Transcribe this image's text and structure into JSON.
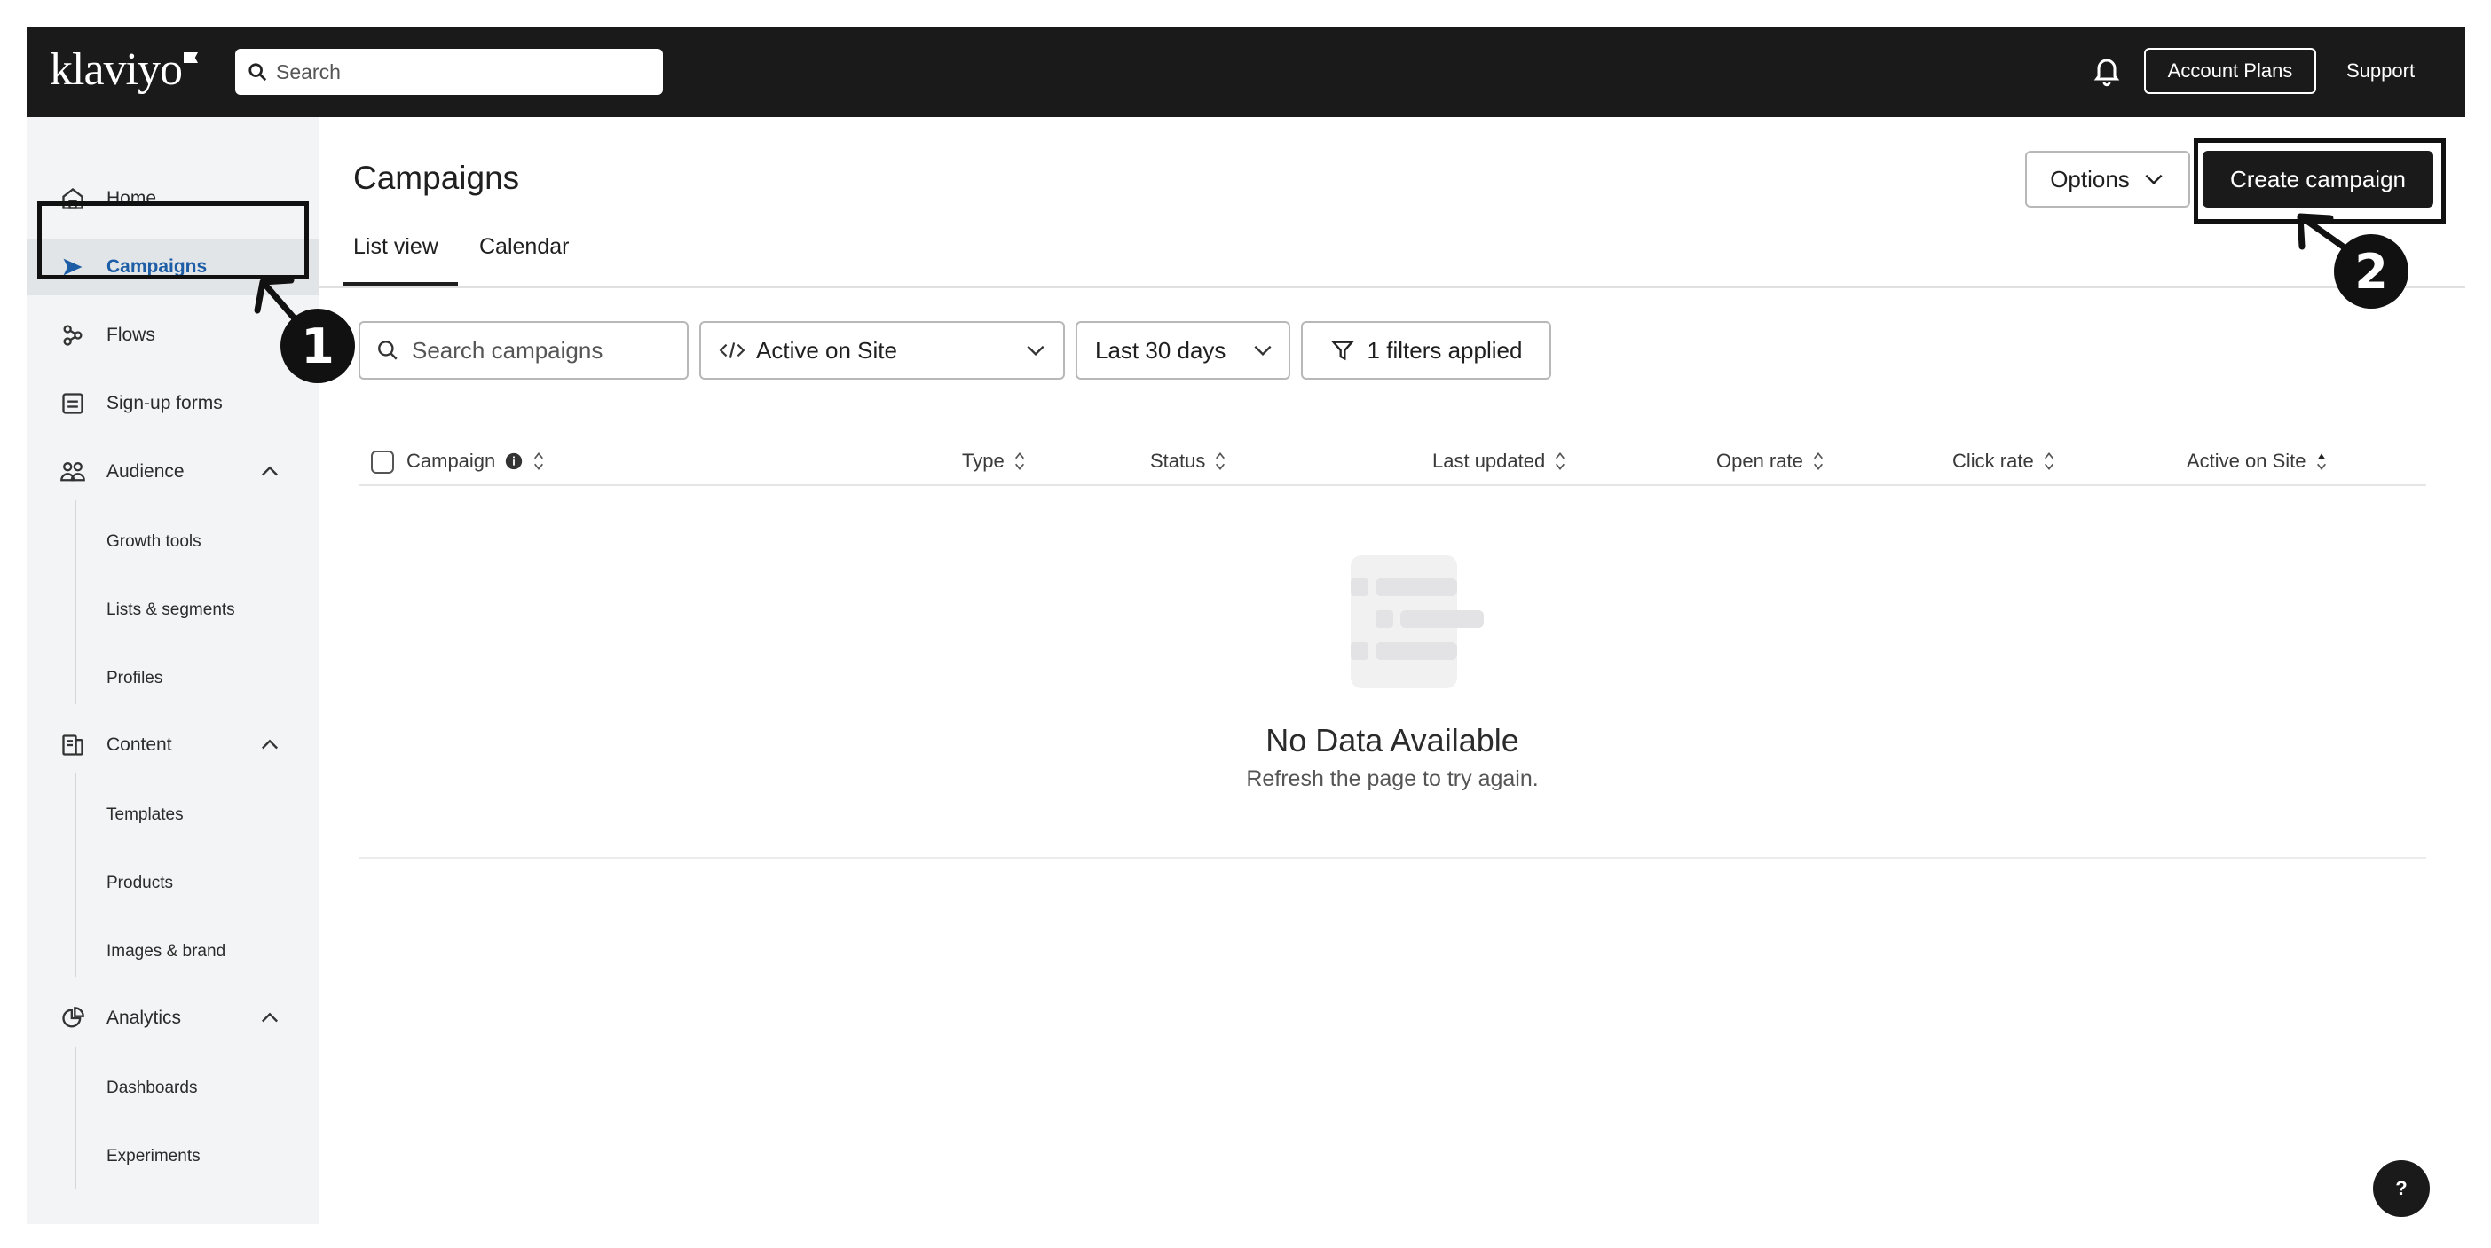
{
  "topbar": {
    "logo_text": "klaviyo",
    "search_placeholder": "Search",
    "account_plans_label": "Account Plans",
    "support_label": "Support"
  },
  "sidebar": {
    "items": [
      {
        "label": "Home",
        "icon": "home-icon"
      },
      {
        "label": "Campaigns",
        "icon": "send-icon",
        "active": true
      },
      {
        "label": "Flows",
        "icon": "flows-icon"
      },
      {
        "label": "Sign-up forms",
        "icon": "form-icon"
      },
      {
        "label": "Audience",
        "icon": "audience-icon",
        "expanded": true
      },
      {
        "label": "Content",
        "icon": "content-icon",
        "expanded": true
      },
      {
        "label": "Analytics",
        "icon": "analytics-icon",
        "expanded": true
      }
    ],
    "audience_sub": [
      "Growth tools",
      "Lists & segments",
      "Profiles"
    ],
    "content_sub": [
      "Templates",
      "Products",
      "Images & brand"
    ],
    "analytics_sub": [
      "Dashboards",
      "Experiments"
    ]
  },
  "main": {
    "title": "Campaigns",
    "tabs": [
      {
        "label": "List view",
        "active": true
      },
      {
        "label": "Calendar",
        "active": false
      }
    ],
    "options_label": "Options",
    "create_label": "Create campaign",
    "filters": {
      "search_placeholder": "Search campaigns",
      "active_select": "Active on Site",
      "date_select": "Last 30 days",
      "filters_applied": "1 filters applied"
    },
    "table": {
      "columns": [
        "Campaign",
        "Type",
        "Status",
        "Last updated",
        "Open rate",
        "Click rate",
        "Active on Site"
      ]
    },
    "empty": {
      "title": "No Data Available",
      "subtitle": "Refresh the page to try again."
    }
  },
  "annotations": {
    "marker_1": "1",
    "marker_2": "2"
  },
  "help_label": "?",
  "colors": {
    "topbar": "#1a1a1a",
    "sidebar_bg": "#f3f4f5",
    "active_nav": "#1c5da6",
    "primary_button": "#1a1a1a"
  }
}
